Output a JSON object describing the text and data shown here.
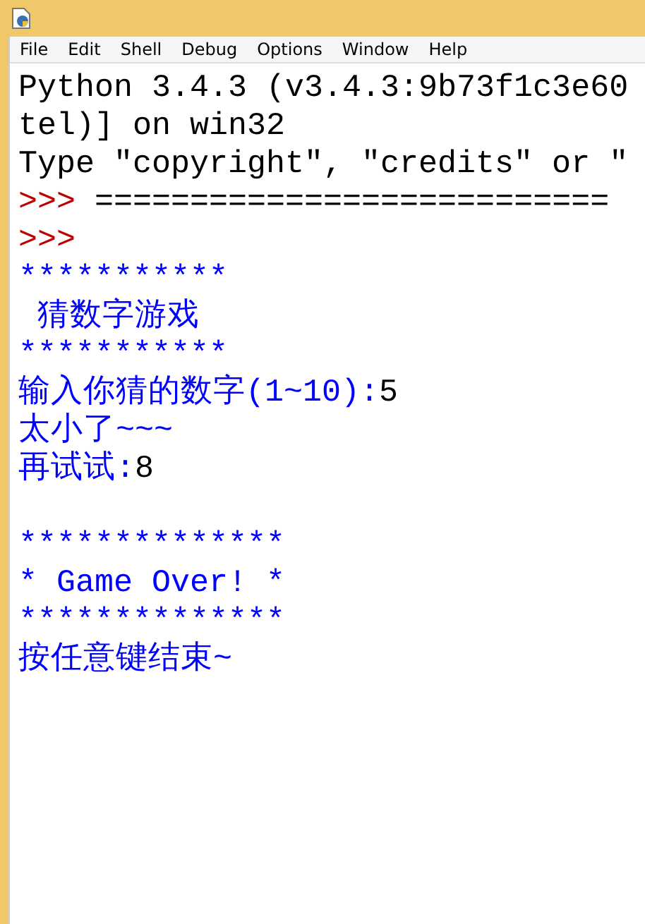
{
  "menu": [
    "File",
    "Edit",
    "Shell",
    "Debug",
    "Options",
    "Window",
    "Help"
  ],
  "lines": [
    [
      {
        "kind": "text",
        "text": "Python 3.4.3 (v3.4.3:9b73f1c3e60"
      }
    ],
    [
      {
        "kind": "text",
        "text": "tel)] on win32"
      }
    ],
    [
      {
        "kind": "text",
        "text": "Type \"copyright\", \"credits\" or \""
      }
    ],
    [
      {
        "kind": "prompt",
        "text": ">>>"
      },
      {
        "kind": "text",
        "text": " ==========================="
      }
    ],
    [
      {
        "kind": "prompt",
        "text": ">>>"
      }
    ],
    [
      {
        "kind": "output",
        "text": "***********"
      }
    ],
    [
      {
        "kind": "output",
        "text": " 猜数字游戏"
      }
    ],
    [
      {
        "kind": "output",
        "text": "***********"
      }
    ],
    [
      {
        "kind": "output",
        "text": "输入你猜的数字(1~10):"
      },
      {
        "kind": "input",
        "text": "5"
      }
    ],
    [
      {
        "kind": "output",
        "text": "太小了~~~"
      }
    ],
    [
      {
        "kind": "output",
        "text": "再试试:"
      },
      {
        "kind": "input",
        "text": "8"
      }
    ],
    {
      "kind": "blank"
    },
    [
      {
        "kind": "output",
        "text": "**************"
      }
    ],
    [
      {
        "kind": "output",
        "text": "* Game Over! *"
      }
    ],
    [
      {
        "kind": "output",
        "text": "**************"
      }
    ],
    [
      {
        "kind": "output",
        "text": "按任意键结束~"
      }
    ]
  ]
}
